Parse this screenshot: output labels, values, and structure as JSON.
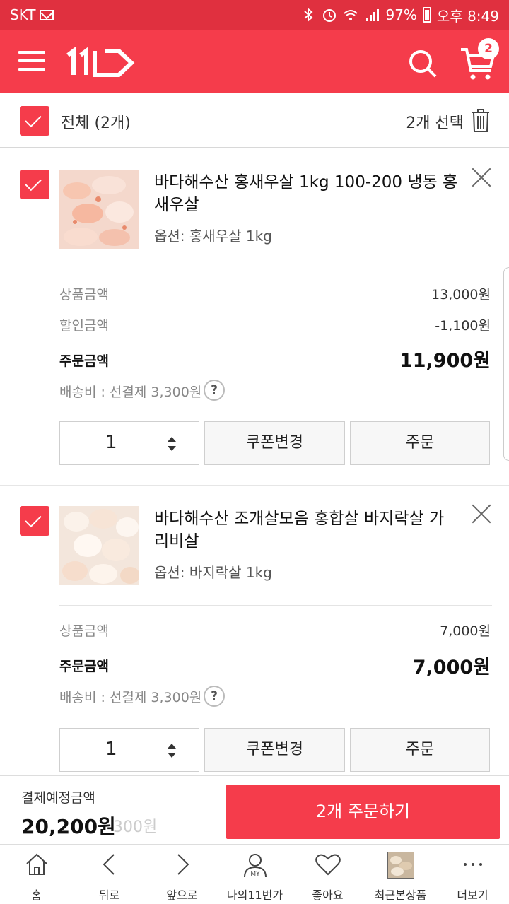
{
  "status_bar": {
    "carrier": "SKT",
    "battery": "97%",
    "time": "오후 8:49"
  },
  "header": {
    "logo": "11",
    "cart_count": "2"
  },
  "select_bar": {
    "select_all_label": "전체 (2개)",
    "selected_label": "2개 선택"
  },
  "items": [
    {
      "title": "바다해수산 홍새우살 1kg 100-200 냉동 홍새우살",
      "option": "옵션: 홍새우살 1kg",
      "product_amount_label": "상품금액",
      "product_amount": "13,000원",
      "discount_label": "할인금액",
      "discount": "-1,100원",
      "order_amount_label": "주문금액",
      "order_amount": "11,900원",
      "shipping": "배송비 : 선결제 3,300원",
      "quantity": "1",
      "coupon_label": "쿠폰변경",
      "order_label": "주문"
    },
    {
      "title": "바다해수산 조개살모음 홍합살 바지락살 가리비살",
      "option": "옵션: 바지락살 1kg",
      "product_amount_label": "상품금액",
      "product_amount": "7,000원",
      "order_amount_label": "주문금액",
      "order_amount": "7,000원",
      "shipping": "배송비 : 선결제 3,300원",
      "quantity": "1",
      "coupon_label": "쿠폰변경",
      "order_label": "주문"
    }
  ],
  "checkout": {
    "label": "결제예정금액",
    "total": "20,200원",
    "ghost_text": "300원",
    "order_button": "2개 주문하기"
  },
  "bottom_nav": [
    {
      "label": "홈",
      "icon": "home-icon"
    },
    {
      "label": "뒤로",
      "icon": "back-icon"
    },
    {
      "label": "앞으로",
      "icon": "forward-icon"
    },
    {
      "label": "나의11번가",
      "icon": "my-icon"
    },
    {
      "label": "좋아요",
      "icon": "heart-icon"
    },
    {
      "label": "최근본상품",
      "icon": "recent-thumbnail"
    },
    {
      "label": "더보기",
      "icon": "more-icon"
    }
  ],
  "help_glyph": "?",
  "my_icon_text": "MY",
  "colors": {
    "brand": "#f53c4b",
    "status_bar": "#e0303f"
  }
}
